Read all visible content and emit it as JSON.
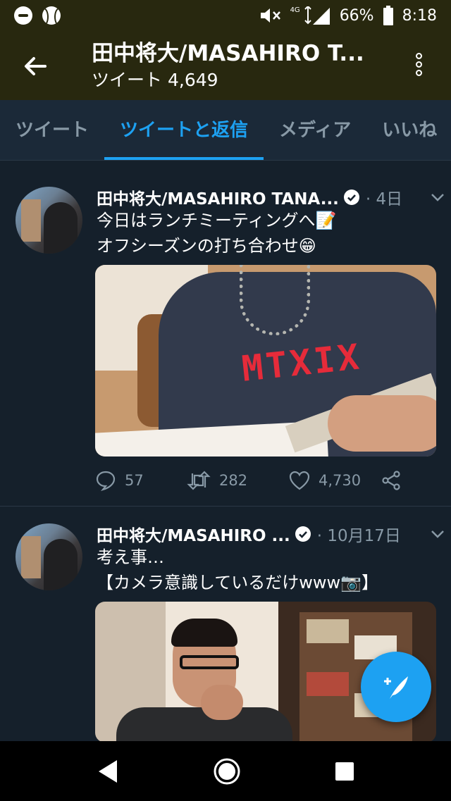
{
  "status_bar": {
    "battery": "66%",
    "time": "8:18",
    "network": "4G",
    "icons": [
      "do-not-disturb-icon",
      "baseball-icon",
      "mute-icon",
      "signal-icon",
      "battery-icon"
    ]
  },
  "header": {
    "title": "田中将大/MASAHIRO T...",
    "tweet_count_label": "ツイート",
    "tweet_count": "4,649"
  },
  "tabs": [
    {
      "label": "ツイート",
      "active": false
    },
    {
      "label": "ツイートと返信",
      "active": true
    },
    {
      "label": "メディア",
      "active": false
    },
    {
      "label": "いいね",
      "active": false
    }
  ],
  "tweets": [
    {
      "name": "田中将大/MASAHIRO TANA...",
      "date": "· 4日",
      "text_line1": "今日はランチミーティングへ📝",
      "text_line2": "オフシーズンの打ち合わせ😁",
      "photo_text": "MTXIX",
      "replies": "57",
      "retweets": "282",
      "likes": "4,730"
    },
    {
      "name": "田中将大/MASAHIRO ...",
      "date": "· 10月17日",
      "text_line1": "考え事…",
      "text_line2": "【カメラ意識しているだけwww📷】"
    }
  ],
  "colors": {
    "accent": "#1da1f2",
    "background": "#15202b",
    "header": "#28280f"
  }
}
